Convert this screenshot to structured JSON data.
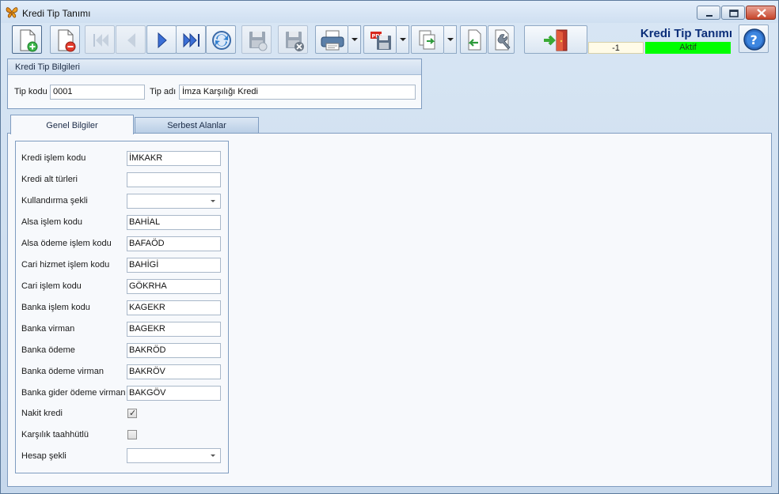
{
  "window": {
    "title": "Kredi Tip Tanımı"
  },
  "header": {
    "screen_title": "Kredi Tip Tanımı",
    "record_number": "-1",
    "status": "Aktif",
    "status_color": "#00ff00"
  },
  "toolbar": {
    "buttons": [
      {
        "name": "new-record-button",
        "icon": "new-document-plus-icon"
      },
      {
        "name": "delete-record-button",
        "icon": "delete-document-icon"
      },
      {
        "name": "first-record-button",
        "icon": "first-icon"
      },
      {
        "name": "previous-record-button",
        "icon": "previous-icon"
      },
      {
        "name": "next-record-button",
        "icon": "next-icon"
      },
      {
        "name": "last-record-button",
        "icon": "last-icon"
      },
      {
        "name": "refresh-button",
        "icon": "refresh-icon"
      },
      {
        "name": "save-button",
        "icon": "save-icon"
      },
      {
        "name": "save-cancel-button",
        "icon": "save-cancel-icon"
      },
      {
        "name": "print-button",
        "icon": "printer-icon"
      },
      {
        "name": "pdf-export-button",
        "icon": "pdf-save-icon"
      },
      {
        "name": "export-button",
        "icon": "export-icon"
      },
      {
        "name": "import-button",
        "icon": "import-icon"
      },
      {
        "name": "settings-button",
        "icon": "wrench-icon"
      },
      {
        "name": "exit-button",
        "icon": "exit-door-icon"
      },
      {
        "name": "help-button",
        "icon": "help-icon"
      }
    ]
  },
  "info_group": {
    "header": "Kredi Tip Bilgileri",
    "code_label": "Tip kodu",
    "code_value": "0001",
    "name_label": "Tip adı",
    "name_value": "İmza Karşılığı Kredi"
  },
  "tabs": [
    {
      "label": "Genel Bilgiler",
      "active": true
    },
    {
      "label": "Serbest Alanlar",
      "active": false
    }
  ],
  "general": {
    "fields": [
      {
        "label": "Kredi işlem kodu",
        "value": "İMKAKR",
        "type": "text"
      },
      {
        "label": "Kredi alt türleri",
        "value": "",
        "type": "text"
      },
      {
        "label": "Kullandırma şekli",
        "value": "",
        "type": "select"
      },
      {
        "label": "Alsa işlem kodu",
        "value": "BAHİAL",
        "type": "text"
      },
      {
        "label": "Alsa ödeme işlem kodu",
        "value": "BAFAÖD",
        "type": "text"
      },
      {
        "label": "Cari hizmet işlem kodu",
        "value": "BAHİGİ",
        "type": "text"
      },
      {
        "label": "Cari işlem kodu",
        "value": "GÖKRHA",
        "type": "text"
      },
      {
        "label": "Banka işlem kodu",
        "value": "KAGEKR",
        "type": "text"
      },
      {
        "label": "Banka virman",
        "value": "BAGEKR",
        "type": "text"
      },
      {
        "label": "Banka ödeme",
        "value": "BAKRÖD",
        "type": "text"
      },
      {
        "label": "Banka ödeme virman",
        "value": "BAKRÖV",
        "type": "text"
      },
      {
        "label": "Banka gider ödeme virman",
        "value": "BAKGÖV",
        "type": "text"
      }
    ],
    "checks": [
      {
        "label": "Nakit kredi",
        "checked": true
      },
      {
        "label": "Karşılık taahhütlü",
        "checked": false
      }
    ],
    "account_label": "Hesap şekli",
    "account_value": ""
  }
}
